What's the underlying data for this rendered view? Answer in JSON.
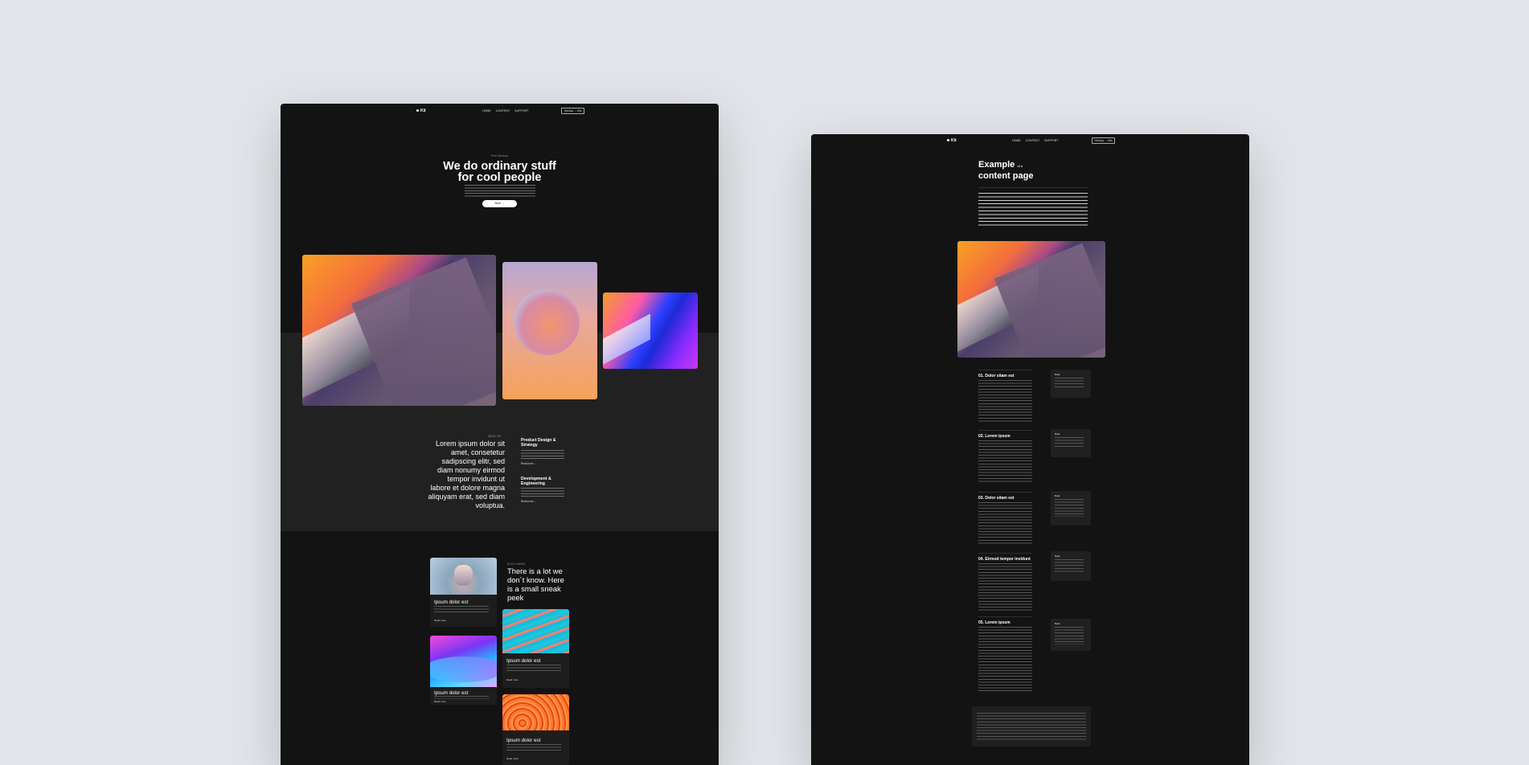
{
  "page1": {
    "nav": {
      "logo": "Kit",
      "links": [
        "HOME",
        "CONTENT",
        "SUPPORT"
      ],
      "button": "Mockup → Kits"
    },
    "hero": {
      "eyebrow": "Free Mockup",
      "title_line1": "We do ordinary stuff",
      "title_line2": "for cool people",
      "cta": "More →"
    },
    "about": {
      "eyebrow": "ABOUT US",
      "statement": [
        "Lorem ipsum dolor sit",
        "amet, consetetur",
        "sadipscing elitr, sed",
        "diam nonumy eirmod",
        "tempor invidunt ut",
        "labore et dolore magna",
        "aliquyam erat, sed diam",
        "voluptua."
      ],
      "services": [
        {
          "title_line1": "Product Design &",
          "title_line2": "Strategy",
          "link": "Read more →"
        },
        {
          "title_line1": "Development &",
          "title_line2": "Engineering",
          "link": "Read more →"
        }
      ]
    },
    "blog": {
      "eyebrow": "BLOG & NEWS",
      "title": [
        "There is a lot we",
        "don´t know. Here",
        "is a small sneak",
        "peek"
      ],
      "cards": [
        {
          "title": "Ipsum dolor est",
          "link": "Read more"
        },
        {
          "title": "Ipsum dolor est",
          "link": "Read more"
        },
        {
          "title": "Ipsum dolor est",
          "link": "Read more"
        },
        {
          "title": "Ipsum dolor est",
          "link": "Read more"
        }
      ]
    }
  },
  "page2": {
    "nav": {
      "logo": "Kit",
      "links": [
        "HOME",
        "CONTENT",
        "SUPPORT"
      ],
      "button": "Mockup → Kits"
    },
    "header": {
      "title_word1": "Example",
      "title_small": "of a",
      "title_line2": "content page"
    },
    "sections": [
      {
        "title": "01. Dolor sitam est",
        "note": "Note"
      },
      {
        "title": "02. Lorem ipsum",
        "note": "Note"
      },
      {
        "title": "03. Dolor sitam est",
        "note": "Note"
      },
      {
        "title": "04. Eirmod tempor invidunt",
        "note": "Note"
      },
      {
        "title": "05. Lorem ipsum",
        "note": "Note"
      }
    ]
  }
}
